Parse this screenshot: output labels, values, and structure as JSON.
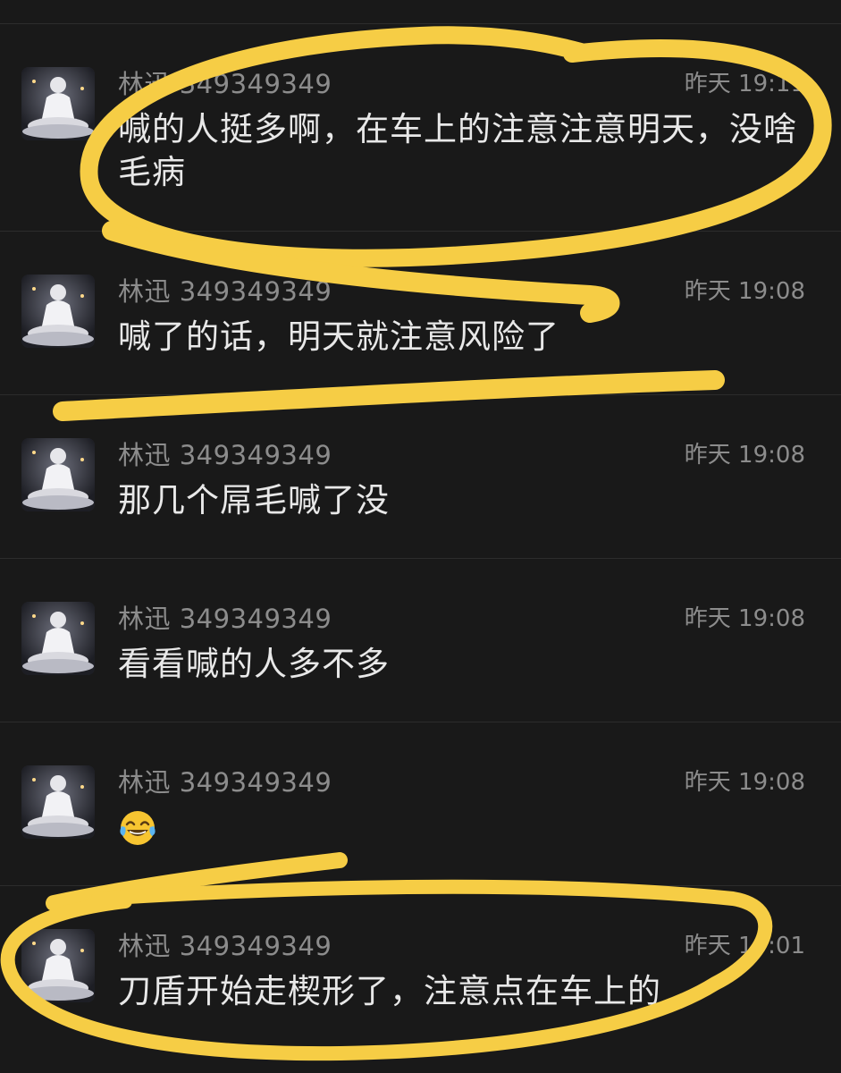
{
  "messages": [
    {
      "name": "林迅 349349349",
      "time": "昨天 19:11",
      "text": "喊的人挺多啊，在车上的注意注意明天，没啥毛病"
    },
    {
      "name": "林迅 349349349",
      "time": "昨天 19:08",
      "text": "喊了的话，明天就注意风险了"
    },
    {
      "name": "林迅 349349349",
      "time": "昨天 19:08",
      "text": "那几个屌毛喊了没"
    },
    {
      "name": "林迅 349349349",
      "time": "昨天 19:08",
      "text": "看看喊的人多不多"
    },
    {
      "name": "林迅 349349349",
      "time": "昨天 19:08",
      "icon": "laughing-tears-emoji"
    },
    {
      "name": "林迅 349349349",
      "time": "昨天 19:01",
      "text": "刀盾开始走楔形了，注意点在车上的"
    }
  ],
  "colors": {
    "background": "#191919",
    "meta_text": "#8c8c8c",
    "message_text": "#e8e8e8",
    "divider": "#2c2c2c",
    "highlight_marker": "#f6cd45"
  }
}
